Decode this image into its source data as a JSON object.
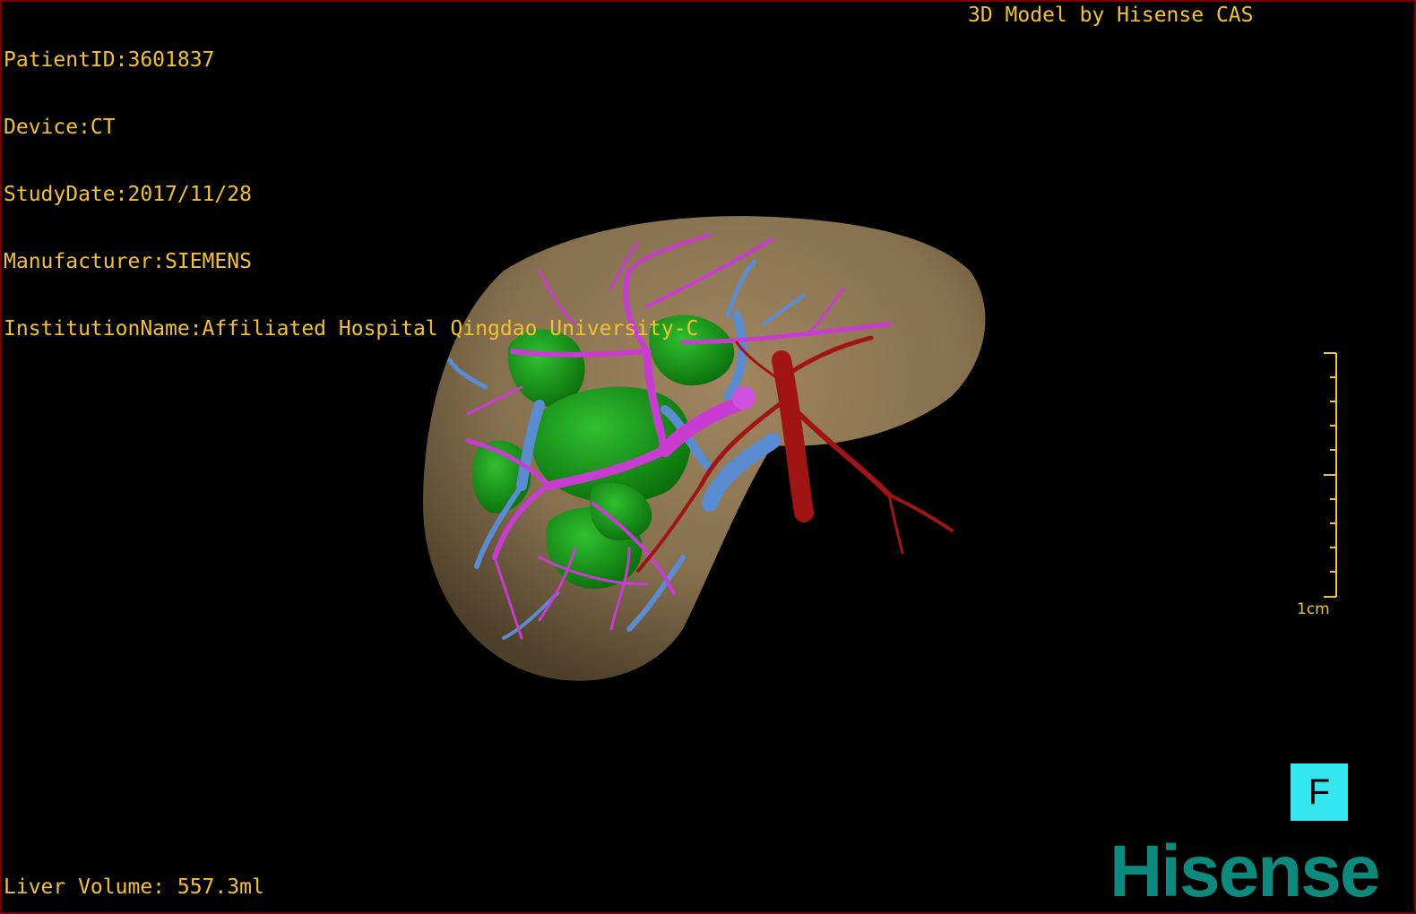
{
  "header_info": {
    "patient_id": "PatientID:3601837",
    "device": "Device:CT",
    "study_date": "StudyDate:2017/11/28",
    "manufacturer": "Manufacturer:SIEMENS",
    "institution": "InstitutionName:Affiliated Hospital Qingdao University-C"
  },
  "credit": "3D Model by Hisense CAS",
  "liver_volume": "Liver Volume: 557.3ml",
  "scale_bar": {
    "label": "1cm"
  },
  "orientation": {
    "label": "F"
  },
  "brand": "Hisense",
  "colors": {
    "text": "#f2c230",
    "liver": "#8c7350",
    "tumor": "#149614",
    "portal_vein": "#c83cd2",
    "hepatic_vein": "#5a8cd2",
    "artery": "#a01414",
    "orientation_cube": "#33e6f0",
    "brand": "#0c8a7e"
  }
}
